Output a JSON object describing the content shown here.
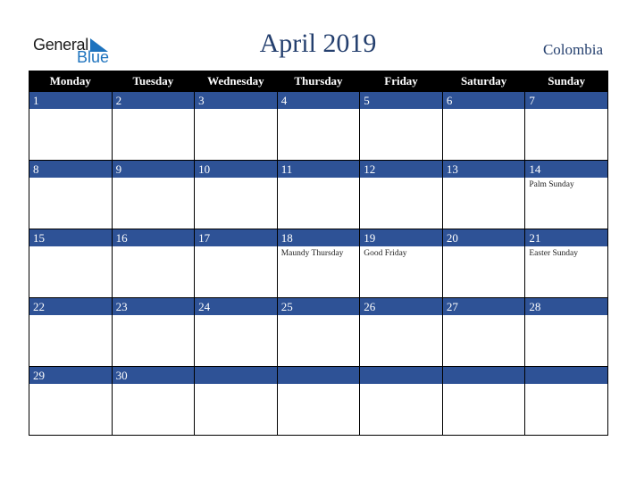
{
  "logo": {
    "word1": "General",
    "word2": "Blue",
    "accent": "#1e73be"
  },
  "header": {
    "title": "April 2019",
    "country": "Colombia"
  },
  "colors": {
    "header_bg": "#000000",
    "date_bar": "#2e5296",
    "title": "#243f6e"
  },
  "weekdays": [
    "Monday",
    "Tuesday",
    "Wednesday",
    "Thursday",
    "Friday",
    "Saturday",
    "Sunday"
  ],
  "weeks": [
    [
      {
        "d": "1",
        "h": ""
      },
      {
        "d": "2",
        "h": ""
      },
      {
        "d": "3",
        "h": ""
      },
      {
        "d": "4",
        "h": ""
      },
      {
        "d": "5",
        "h": ""
      },
      {
        "d": "6",
        "h": ""
      },
      {
        "d": "7",
        "h": ""
      }
    ],
    [
      {
        "d": "8",
        "h": ""
      },
      {
        "d": "9",
        "h": ""
      },
      {
        "d": "10",
        "h": ""
      },
      {
        "d": "11",
        "h": ""
      },
      {
        "d": "12",
        "h": ""
      },
      {
        "d": "13",
        "h": ""
      },
      {
        "d": "14",
        "h": "Palm Sunday"
      }
    ],
    [
      {
        "d": "15",
        "h": ""
      },
      {
        "d": "16",
        "h": ""
      },
      {
        "d": "17",
        "h": ""
      },
      {
        "d": "18",
        "h": "Maundy Thursday"
      },
      {
        "d": "19",
        "h": "Good Friday"
      },
      {
        "d": "20",
        "h": ""
      },
      {
        "d": "21",
        "h": "Easter Sunday"
      }
    ],
    [
      {
        "d": "22",
        "h": ""
      },
      {
        "d": "23",
        "h": ""
      },
      {
        "d": "24",
        "h": ""
      },
      {
        "d": "25",
        "h": ""
      },
      {
        "d": "26",
        "h": ""
      },
      {
        "d": "27",
        "h": ""
      },
      {
        "d": "28",
        "h": ""
      }
    ],
    [
      {
        "d": "29",
        "h": ""
      },
      {
        "d": "30",
        "h": ""
      },
      {
        "d": "",
        "h": ""
      },
      {
        "d": "",
        "h": ""
      },
      {
        "d": "",
        "h": ""
      },
      {
        "d": "",
        "h": ""
      },
      {
        "d": "",
        "h": ""
      }
    ]
  ]
}
